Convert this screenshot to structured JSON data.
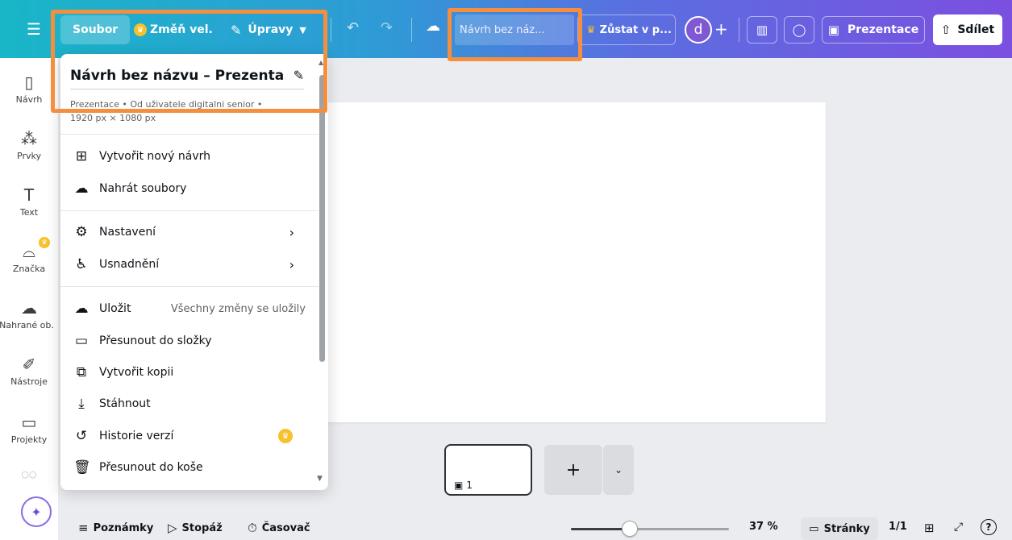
{
  "topbar": {
    "menu_icon": "hamburger-icon",
    "file_label": "Soubor",
    "resize_label": "Změň vel.",
    "edit_label": "Úpravy",
    "design_title": "Návrh bez náz...",
    "stay_pro_label": "Zůstat v p...",
    "avatar_initial": "d",
    "present_label": "Prezentace",
    "share_label": "Sdílet"
  },
  "sidebar": {
    "items": [
      {
        "label": "Návrh",
        "icon": "layout-icon"
      },
      {
        "label": "Prvky",
        "icon": "elements-icon"
      },
      {
        "label": "Text",
        "icon": "text-icon"
      },
      {
        "label": "Značka",
        "icon": "brand-icon"
      },
      {
        "label": "Nahrané ob.",
        "icon": "upload-cloud-icon"
      },
      {
        "label": "Nástroje",
        "icon": "draw-tools-icon"
      },
      {
        "label": "Projekty",
        "icon": "folder-icon"
      }
    ]
  },
  "file_menu": {
    "title": "Návrh bez názvu – Prezenta...",
    "meta_line1": "Prezentace • Od uživatele digitalni senior •",
    "meta_line2": "1920 px × 1080 px",
    "items": [
      {
        "label": "Vytvořit nový návrh",
        "icon": "new-design-icon"
      },
      {
        "label": "Nahrát soubory",
        "icon": "upload-icon"
      },
      {
        "label": "Nastavení",
        "icon": "settings-gear-icon"
      },
      {
        "label": "Usnadnění",
        "icon": "accessibility-icon"
      },
      {
        "label": "Uložit",
        "icon": "cloud-check-icon",
        "aside": "Všechny změny se uložily"
      },
      {
        "label": "Přesunout do složky",
        "icon": "folder-icon"
      },
      {
        "label": "Vytvořit kopii",
        "icon": "copy-icon"
      },
      {
        "label": "Stáhnout",
        "icon": "download-icon"
      },
      {
        "label": "Historie verzí",
        "icon": "history-icon"
      },
      {
        "label": "Přesunout do koše",
        "icon": "trash-icon"
      }
    ]
  },
  "pages": {
    "thumb_number": "1"
  },
  "bottombar": {
    "notes_label": "Poznámky",
    "timing_label": "Stopáž",
    "timer_label": "Časovač",
    "zoom_value": "37 %",
    "zoom_fraction": 0.37,
    "pages_label": "Stránky",
    "page_count": "1/1",
    "help_label": "?"
  },
  "colors": {
    "highlight": "#f58f3e",
    "pro_crown": "#f8c02c",
    "topbar_start": "#19b6c8",
    "topbar_end": "#7b4fe0"
  }
}
